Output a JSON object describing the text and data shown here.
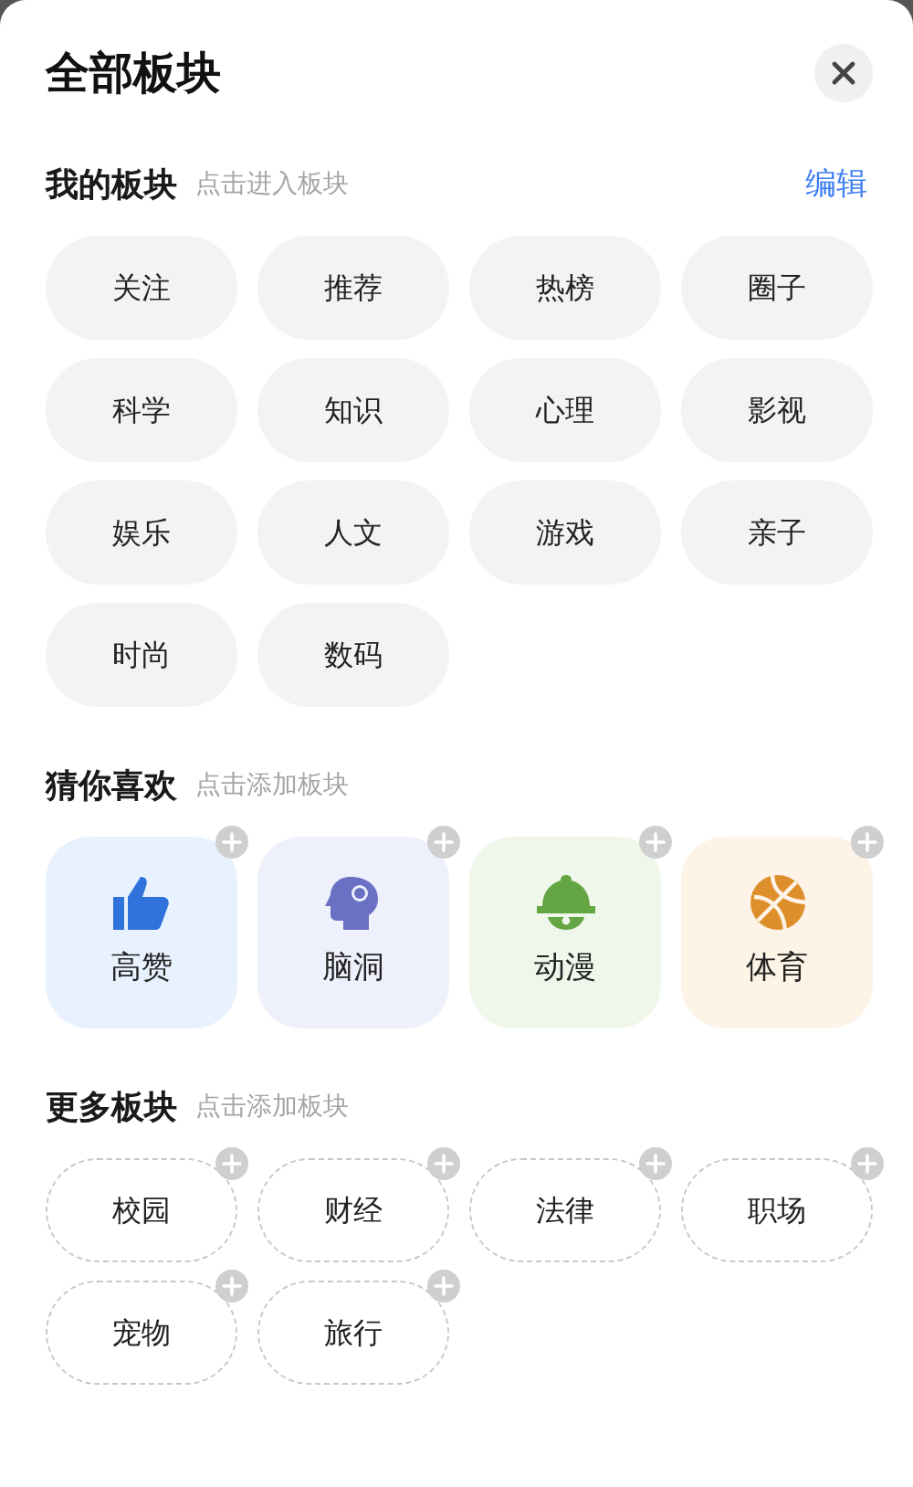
{
  "title": "全部板块",
  "my_sections": {
    "heading": "我的板块",
    "hint": "点击进入板块",
    "edit": "编辑",
    "items": [
      {
        "label": "关注"
      },
      {
        "label": "推荐"
      },
      {
        "label": "热榜"
      },
      {
        "label": "圈子"
      },
      {
        "label": "科学"
      },
      {
        "label": "知识"
      },
      {
        "label": "心理"
      },
      {
        "label": "影视"
      },
      {
        "label": "娱乐"
      },
      {
        "label": "人文"
      },
      {
        "label": "游戏"
      },
      {
        "label": "亲子"
      },
      {
        "label": "时尚"
      },
      {
        "label": "数码"
      }
    ]
  },
  "recommended": {
    "heading": "猜你喜欢",
    "hint": "点击添加板块",
    "items": [
      {
        "label": "高赞",
        "kind": "thumbs",
        "color": "#e8f1fe"
      },
      {
        "label": "脑洞",
        "kind": "head",
        "color": "#eef0fb"
      },
      {
        "label": "动漫",
        "kind": "bell",
        "color": "#eef7ea"
      },
      {
        "label": "体育",
        "kind": "ball",
        "color": "#fdf3e6"
      }
    ]
  },
  "more_sections": {
    "heading": "更多板块",
    "hint": "点击添加板块",
    "items": [
      {
        "label": "校园"
      },
      {
        "label": "财经"
      },
      {
        "label": "法律"
      },
      {
        "label": "职场"
      },
      {
        "label": "宠物"
      },
      {
        "label": "旅行"
      }
    ]
  }
}
